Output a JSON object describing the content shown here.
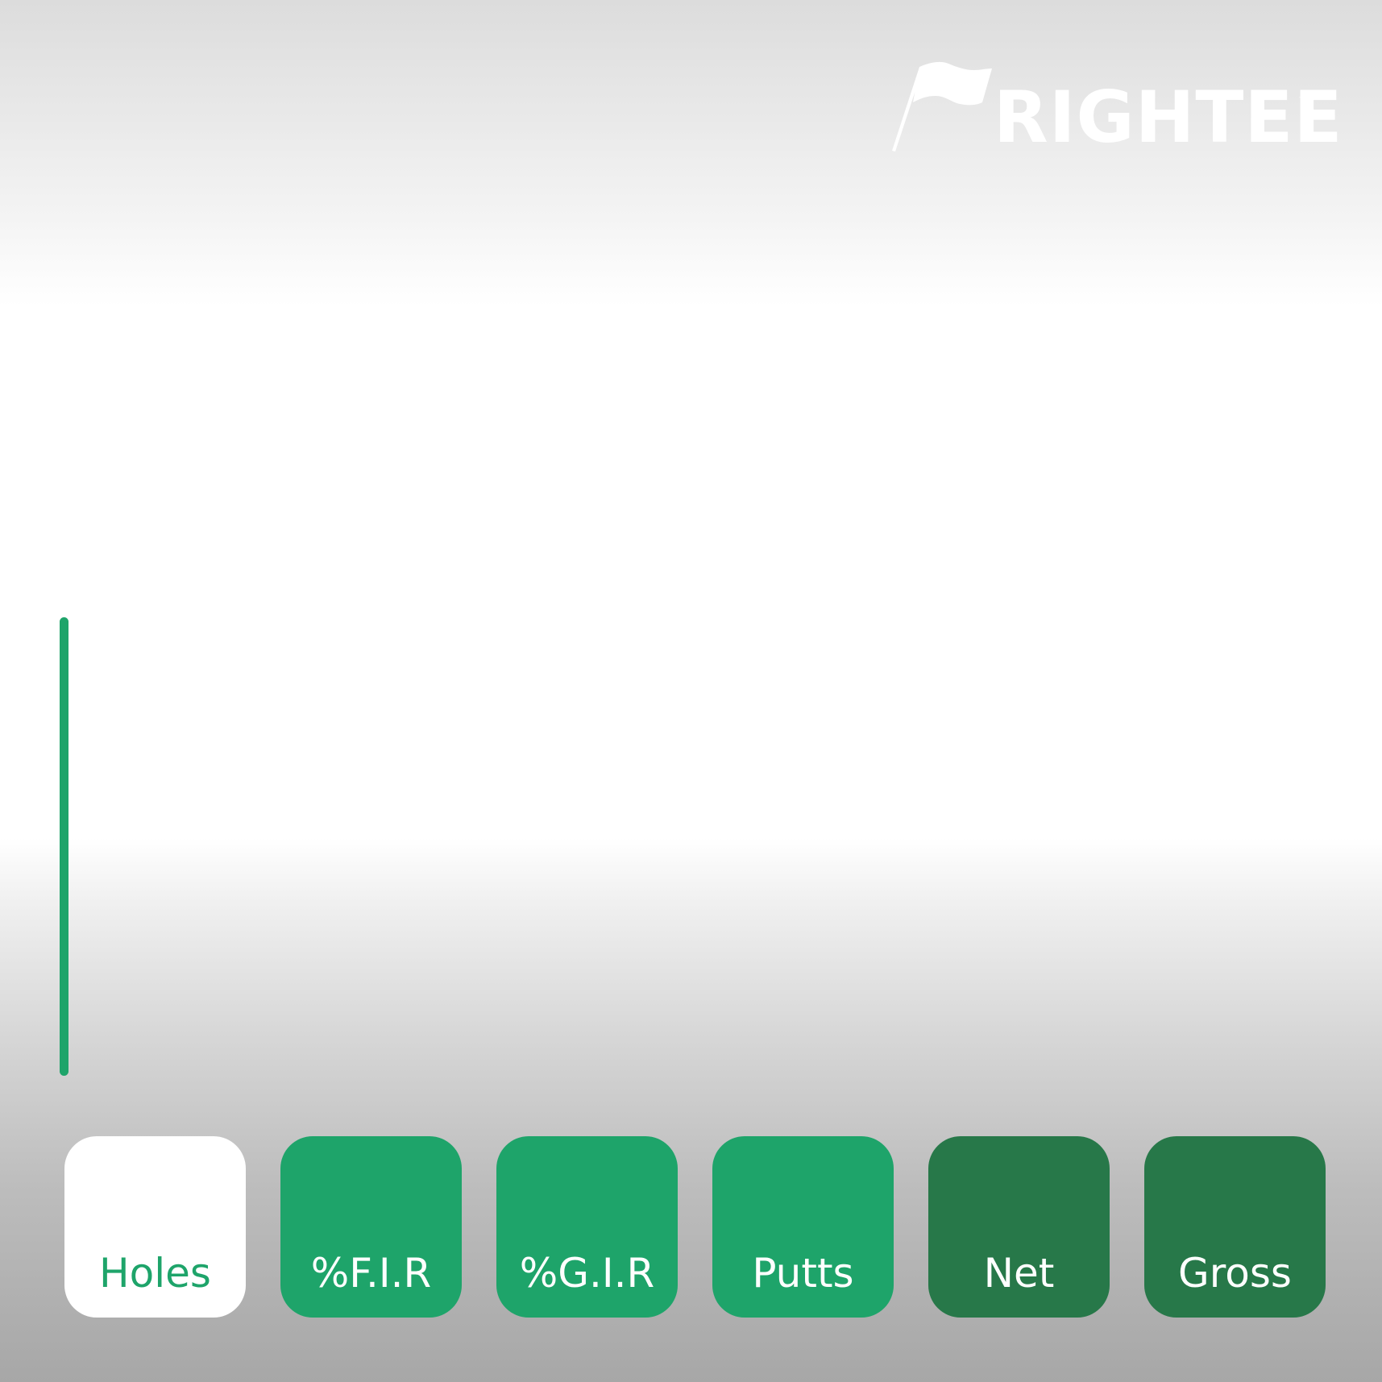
{
  "brand": {
    "name": "RIGHTEE",
    "trademark": "™",
    "logo_icon": "flag-icon"
  },
  "progress": {
    "value": 1.0
  },
  "tiles": [
    {
      "label": "Holes",
      "state": "selected",
      "color": "#ffffff",
      "text_color": "#1ea46a"
    },
    {
      "label": "%F.I.R",
      "state": "default",
      "color": "#1ea46a",
      "text_color": "#ffffff"
    },
    {
      "label": "%G.I.R",
      "state": "default",
      "color": "#1ea46a",
      "text_color": "#ffffff"
    },
    {
      "label": "Putts",
      "state": "default",
      "color": "#1ea46a",
      "text_color": "#ffffff"
    },
    {
      "label": "Net",
      "state": "default",
      "color": "#277849",
      "text_color": "#ffffff"
    },
    {
      "label": "Gross",
      "state": "default",
      "color": "#277849",
      "text_color": "#ffffff"
    }
  ],
  "colors": {
    "accent_green": "#1ea46a",
    "dark_green": "#277849",
    "white": "#ffffff"
  }
}
